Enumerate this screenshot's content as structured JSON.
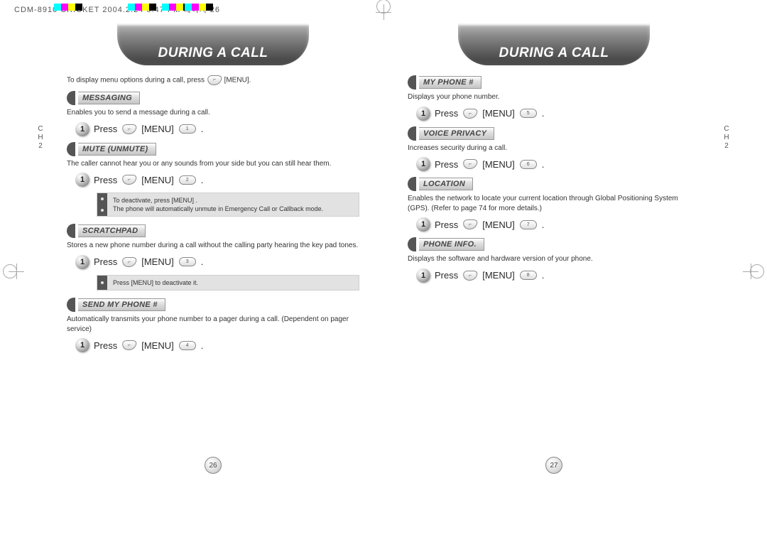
{
  "topbar": "CDM-8910 CRICKET  2004.2.24  5:47 PM  페이지 26",
  "banner": "DURING A CALL",
  "left": {
    "chapter": "C\nH\n2",
    "intro": "To display menu options during a call, press",
    "intro_suffix": "[MENU].",
    "sections": {
      "messaging": {
        "label": "MESSAGING",
        "desc": "Enables you to send a message during a call.",
        "step_press": "Press",
        "step_menu": "[MENU]",
        "key": "1"
      },
      "mute": {
        "label": "MUTE (UNMUTE)",
        "desc": "The caller cannot hear you or any sounds from your side but you can still hear them.",
        "step_press": "Press",
        "step_menu": "[MENU]",
        "key": "2",
        "note_l1": "To deactivate, press      [MENU]      .",
        "note_l2": "The phone will automatically unmute in Emergency Call or Callback mode."
      },
      "scratch": {
        "label": "SCRATCHPAD",
        "desc": "Stores a new phone number during a call without the calling party hearing the key pad tones.",
        "step_press": "Press",
        "step_menu": "[MENU]",
        "key": "3",
        "note": "Press      [MENU]      to deactivate it."
      },
      "sendmy": {
        "label": "SEND MY PHONE #",
        "desc": "Automatically transmits your phone number to a pager during a call. (Dependent on pager service)",
        "step_press": "Press",
        "step_menu": "[MENU]",
        "key": "4"
      }
    },
    "page_num": "26"
  },
  "right": {
    "chapter": "C\nH\n2",
    "sections": {
      "myphone": {
        "label": "MY PHONE #",
        "desc": "Displays your phone number.",
        "step_press": "Press",
        "step_menu": "[MENU]",
        "key": "5"
      },
      "voice": {
        "label": "VOICE PRIVACY",
        "desc": "Increases security during a call.",
        "step_press": "Press",
        "step_menu": "[MENU]",
        "key": "6"
      },
      "location": {
        "label": "LOCATION",
        "desc": "Enables the network to locate your current location through Global Positioning System (GPS). (Refer to page 74 for more details.)",
        "step_press": "Press",
        "step_menu": "[MENU]",
        "key": "7"
      },
      "info": {
        "label": "PHONE INFO.",
        "desc": "Displays the software and hardware version of your phone.",
        "step_press": "Press",
        "step_menu": "[MENU]",
        "key": "8"
      }
    },
    "page_num": "27"
  }
}
